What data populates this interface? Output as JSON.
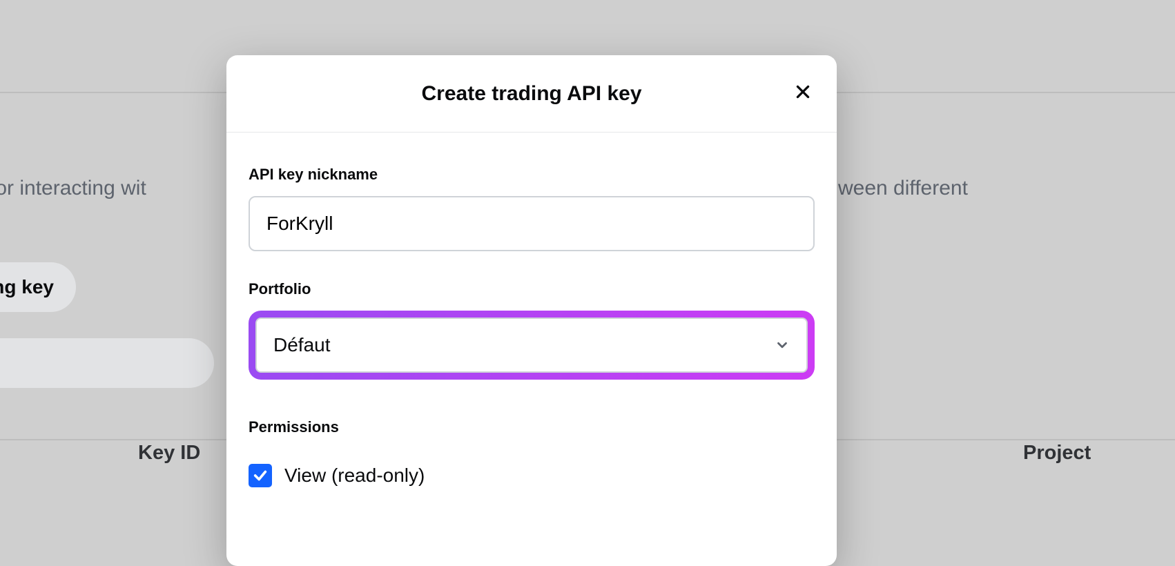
{
  "background": {
    "description_left": "missions for interacting wit",
    "description_right": "ween different",
    "pill_label": "ding key",
    "col_key_id": "Key ID",
    "col_project": "Project"
  },
  "modal": {
    "title": "Create trading API key",
    "nickname_label": "API key nickname",
    "nickname_value": "ForKryll",
    "portfolio_label": "Portfolio",
    "portfolio_selected": "Défaut",
    "permissions_label": "Permissions",
    "permissions": {
      "view_label": "View (read-only)",
      "view_checked": true
    }
  }
}
